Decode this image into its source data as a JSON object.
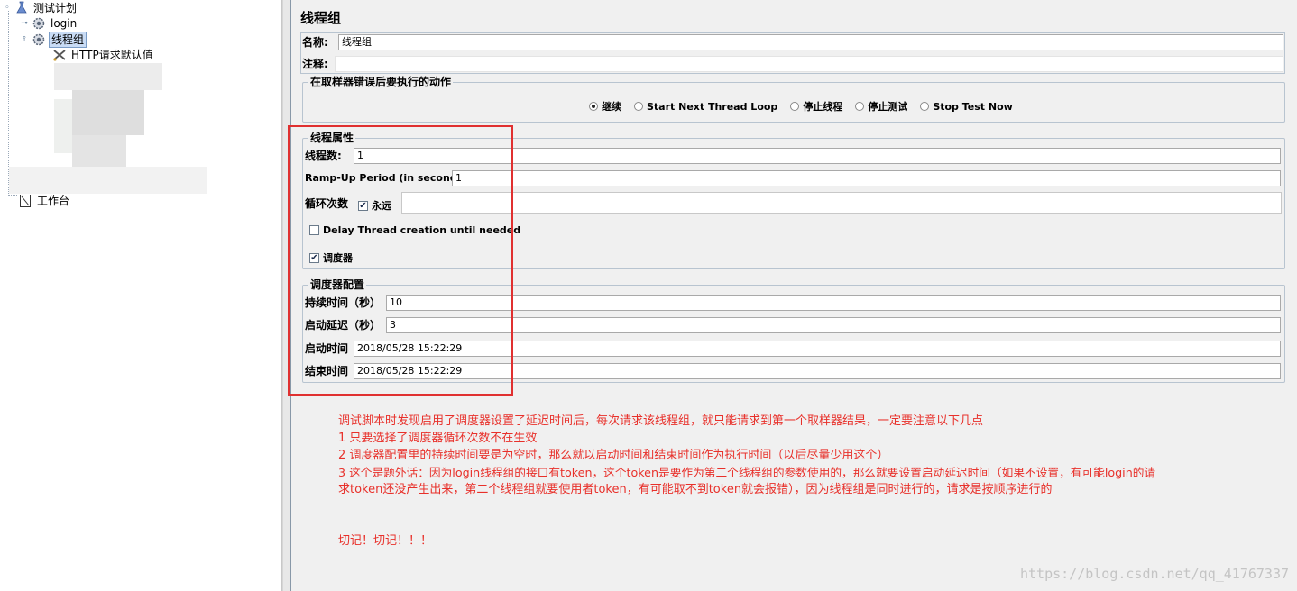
{
  "tree": {
    "root_label": "测试计划",
    "login_label": "login",
    "thread_group_label": "线程组",
    "http_defaults_label": "HTTP请求默认值",
    "workbench_label": "工作台"
  },
  "panel": {
    "title": "线程组",
    "name_label": "名称:",
    "name_value": "线程组",
    "comment_label": "注释:",
    "comment_value": "",
    "error_action": {
      "legend": "在取样器错误后要执行的动作",
      "options": [
        {
          "label": "继续",
          "selected": true
        },
        {
          "label": "Start Next Thread Loop",
          "selected": false
        },
        {
          "label": "停止线程",
          "selected": false
        },
        {
          "label": "停止测试",
          "selected": false
        },
        {
          "label": "Stop Test Now",
          "selected": false
        }
      ]
    },
    "thread_props": {
      "legend": "线程属性",
      "threads_label": "线程数:",
      "threads_value": "1",
      "rampup_label": "Ramp-Up Period (in seconds):",
      "rampup_value": "1",
      "loop_label": "循环次数",
      "forever_label": "永远",
      "forever_checked": true,
      "loop_value": "",
      "delay_label": "Delay Thread creation until needed",
      "delay_checked": false,
      "scheduler_label": "调度器",
      "scheduler_checked": true
    },
    "scheduler_config": {
      "legend": "调度器配置",
      "duration_label": "持续时间（秒）",
      "duration_value": "10",
      "startup_delay_label": "启动延迟（秒）",
      "startup_delay_value": "3",
      "start_time_label": "启动时间",
      "start_time_value": "2018/05/28 15:22:29",
      "end_time_label": "结束时间",
      "end_time_value": "2018/05/28 15:22:29"
    }
  },
  "notes": {
    "line1": "调试脚本时发现启用了调度器设置了延迟时间后，每次请求该线程组，就只能请求到第一个取样器结果，一定要注意以下几点",
    "line2": "1 只要选择了调度器循环次数不在生效",
    "line3": "2 调度器配置里的持续时间要是为空时，那么就以启动时间和结束时间作为执行时间（以后尽量少用这个）",
    "line4": "3 这个是题外话：因为login线程组的接口有token，这个token是要作为第二个线程组的参数使用的，那么就要设置启动延迟时间（如果不设置，有可能login的请",
    "line5": "求token还没产生出来，第二个线程组就要使用者token，有可能取不到token就会报错），因为线程组是同时进行的，请求是按顺序进行的",
    "line6": "切记！切记！！！"
  },
  "watermark": "https://blog.csdn.net/qq_41767337",
  "colors": {
    "annotation_red": "#e8302a",
    "highlight_red": "#e03030"
  }
}
